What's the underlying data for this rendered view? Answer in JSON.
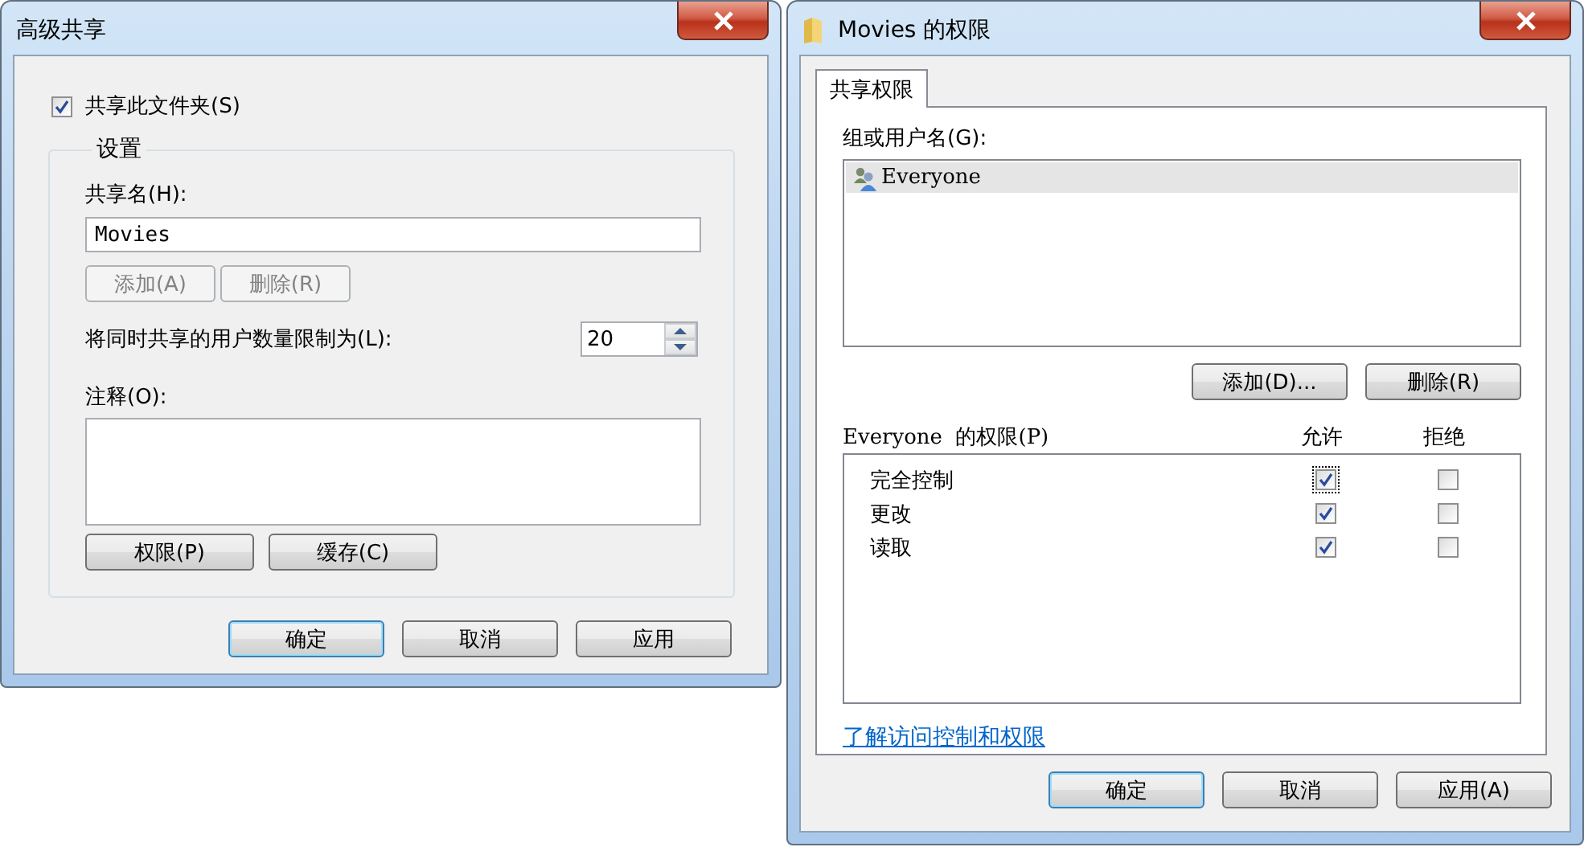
{
  "advanced_sharing_dialog": {
    "title": "高级共享",
    "share_checkbox": {
      "label": "共享此文件夹(S)",
      "checked": true
    },
    "settings_group": {
      "legend": "设置",
      "share_name_label": "共享名(H):",
      "share_name_value": "Movies",
      "add_button": {
        "label": "添加(A)",
        "disabled": true
      },
      "remove_button": {
        "label": "删除(R)",
        "disabled": true
      },
      "limit_label": "将同时共享的用户数量限制为(L):",
      "limit_value": "20",
      "comment_label": "注释(O):",
      "permissions_button": {
        "label": "权限(P)",
        "disabled": false
      },
      "caching_button": {
        "label": "缓存(C)",
        "disabled": false
      }
    },
    "buttons": [
      {
        "label": "确定",
        "default": true
      },
      {
        "label": "取消",
        "default": false
      },
      {
        "label": "应用",
        "default": false
      }
    ]
  },
  "permissions_dialog": {
    "title": "Movies 的权限",
    "tabs": [
      {
        "label": "共享权限",
        "selected": true
      }
    ],
    "group_label": "组或用户名(G):",
    "users": [
      {
        "name": "Everyone",
        "selected": true
      }
    ],
    "add_button": "添加(D)...",
    "remove_button": "删除(R)",
    "permissions_header": {
      "label": "Everyone  的权限(P)",
      "allow": "允许",
      "deny": "拒绝"
    },
    "permissions": [
      {
        "name": "完全控制",
        "allow": true,
        "deny": false,
        "focused": true
      },
      {
        "name": "更改",
        "allow": true,
        "deny": false,
        "focused": false
      },
      {
        "name": "读取",
        "allow": true,
        "deny": false,
        "focused": false
      }
    ],
    "link": "了解访问控制和权限",
    "buttons": [
      {
        "label": "确定",
        "default": true
      },
      {
        "label": "取消",
        "default": false
      },
      {
        "label": "应用(A)",
        "default": false
      }
    ]
  }
}
